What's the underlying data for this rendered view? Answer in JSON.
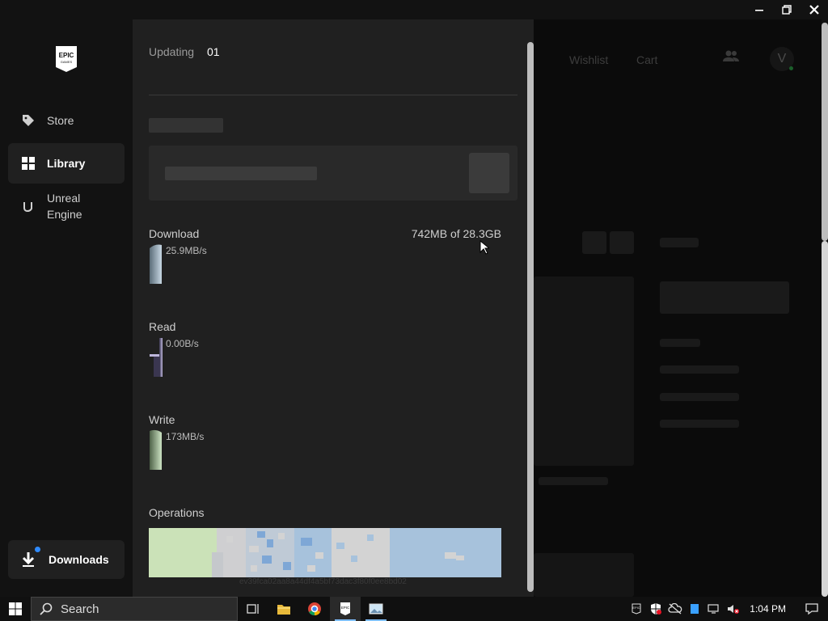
{
  "window": {
    "controls": [
      "minimize",
      "restore",
      "close"
    ]
  },
  "nav": {
    "logo_text": "EPIC GAMES",
    "items": [
      {
        "label": "Store",
        "icon": "tag-icon"
      },
      {
        "label": "Library",
        "icon": "grid-icon",
        "active": true
      },
      {
        "label": "Unreal Engine",
        "icon": "unreal-icon"
      }
    ],
    "downloads": {
      "label": "Downloads",
      "icon": "download-icon",
      "indicator": true
    }
  },
  "background": {
    "links": [
      "Wishlist",
      "Cart"
    ],
    "avatar_letter": "V"
  },
  "panel": {
    "header_label": "Updating",
    "header_count": "01",
    "download": {
      "label": "Download",
      "rate": "25.9MB/s",
      "total": "742MB of 28.3GB"
    },
    "read": {
      "label": "Read",
      "rate": "0.00B/s"
    },
    "write": {
      "label": "Write",
      "rate": "173MB/s"
    },
    "operations": {
      "label": "Operations",
      "code": "ev39fca02aa8a44df4a5bf73dac3f80f0ee8bd02"
    }
  },
  "taskbar": {
    "search_placeholder": "Search",
    "apps": [
      "task-view-icon",
      "file-explorer-icon",
      "chrome-icon",
      "epic-games-icon",
      "photos-icon"
    ],
    "tray_text": "EPIC",
    "time": "1:04 PM"
  },
  "colors": {
    "panel_bg": "#202020",
    "nav_bg": "#121212",
    "accent_blue": "#2f8bff",
    "ops_green": "#c8e0b4",
    "ops_blue": "#9fbfdc"
  }
}
